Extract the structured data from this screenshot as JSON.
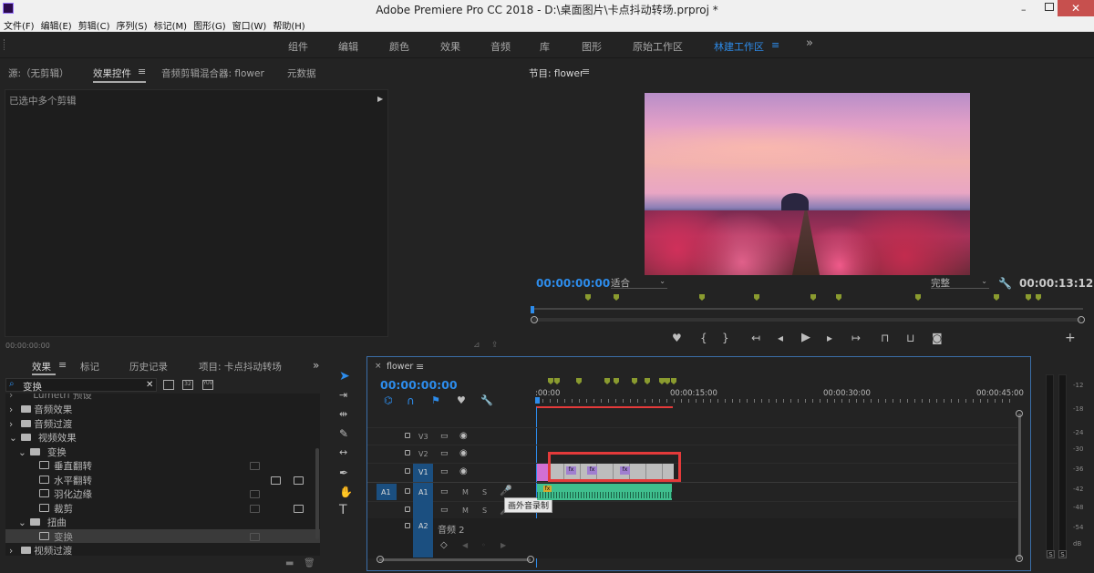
{
  "window": {
    "title": "Adobe Premiere Pro CC 2018 - D:\\桌面图片\\卡点抖动转场.prproj *"
  },
  "menu": [
    "文件(F)",
    "编辑(E)",
    "剪辑(C)",
    "序列(S)",
    "标记(M)",
    "图形(G)",
    "窗口(W)",
    "帮助(H)"
  ],
  "workspaces": [
    "组件",
    "编辑",
    "颜色",
    "效果",
    "音频",
    "库",
    "图形",
    "原始工作区",
    "林建工作区"
  ],
  "workspace_active": "林建工作区",
  "overflow": "»",
  "source_panel": {
    "tabs": [
      "源:（无剪辑）",
      "效果控件",
      "音频剪辑混合器: flower",
      "元数据"
    ],
    "active": "效果控件",
    "message": "已选中多个剪辑",
    "timecode": "00:00:00:00"
  },
  "program": {
    "title": "节目: flower",
    "timecode_left": "00:00:00:00",
    "fit": "适合",
    "quality": "完整",
    "timecode_right": "00:00:13:12"
  },
  "effects_panel": {
    "tabs": [
      "效果",
      "标记",
      "历史记录",
      "项目: 卡点抖动转场"
    ],
    "search": "变换",
    "items": [
      {
        "label": "Lumetri 预设",
        "level": 0
      },
      {
        "label": "音频效果",
        "level": 0
      },
      {
        "label": "音频过渡",
        "level": 0
      },
      {
        "label": "视频效果",
        "level": 0
      },
      {
        "label": "变换",
        "level": 1
      },
      {
        "label": "垂直翻转",
        "level": 2
      },
      {
        "label": "水平翻转",
        "level": 2
      },
      {
        "label": "羽化边缘",
        "level": 2
      },
      {
        "label": "裁剪",
        "level": 2
      },
      {
        "label": "扭曲",
        "level": 1
      },
      {
        "label": "变换",
        "level": 2
      },
      {
        "label": "视频过渡",
        "level": 0
      }
    ]
  },
  "tools": [
    "selection-tool",
    "track-select-tool",
    "ripple-edit-tool",
    "razor-tool",
    "slip-tool",
    "pen-tool",
    "hand-tool",
    "type-tool"
  ],
  "timeline": {
    "tab": "flower",
    "timecode": "00:00:00:00",
    "ruler": [
      ":00:00",
      "00:00:15:00",
      "00:00:30:00",
      "00:00:45:00"
    ],
    "tracks": {
      "v3": "V3",
      "v2": "V2",
      "v1": "V1",
      "a1": "A1",
      "a2": "A2",
      "a1_src": "A1",
      "audio2": "音频 2",
      "m": "M",
      "s": "S"
    },
    "tooltip": "画外音录制",
    "fx": "fx"
  },
  "meters": {
    "labels": [
      "-12",
      "-18",
      "-24",
      "-30",
      "-36",
      "-42",
      "-48",
      "-54",
      "dB"
    ],
    "solo": "S"
  },
  "colors": {
    "accent": "#2d8ceb",
    "highlight": "#e43a3a",
    "video_clip": "#bfbfbf",
    "audio_clip": "#3fbf8e",
    "marker": "#8a9b2f",
    "nest": "#d26fd2"
  }
}
